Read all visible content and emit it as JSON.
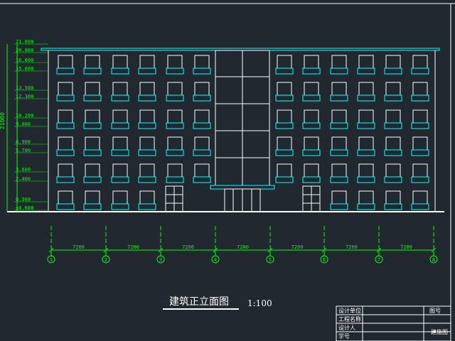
{
  "title_block": {
    "cells": [
      "设计单位",
      "工程名称",
      "设计人",
      "学号"
    ],
    "drawing_no_label": "图号",
    "sheet_label": "建施图"
  },
  "drawing": {
    "title": "建筑正立面图",
    "scale": "1:100",
    "total_height_label": "21000",
    "elevation_labels": [
      "21.000",
      "20.000",
      "16.800",
      "15.600",
      "13.500",
      "12.300",
      "10.200",
      "9.000",
      "6.900",
      "5.700",
      "3.600",
      "2.400",
      "0.300",
      "±0.000"
    ],
    "bay_dimension": "7200",
    "axis_numbers": [
      "1",
      "2",
      "3",
      "4",
      "5",
      "6",
      "7",
      "8"
    ]
  },
  "colors": {
    "background": "#212830",
    "line": "#ffffff",
    "window": "#00ffff",
    "dimension": "#00ff00",
    "text": "#ffffff"
  }
}
